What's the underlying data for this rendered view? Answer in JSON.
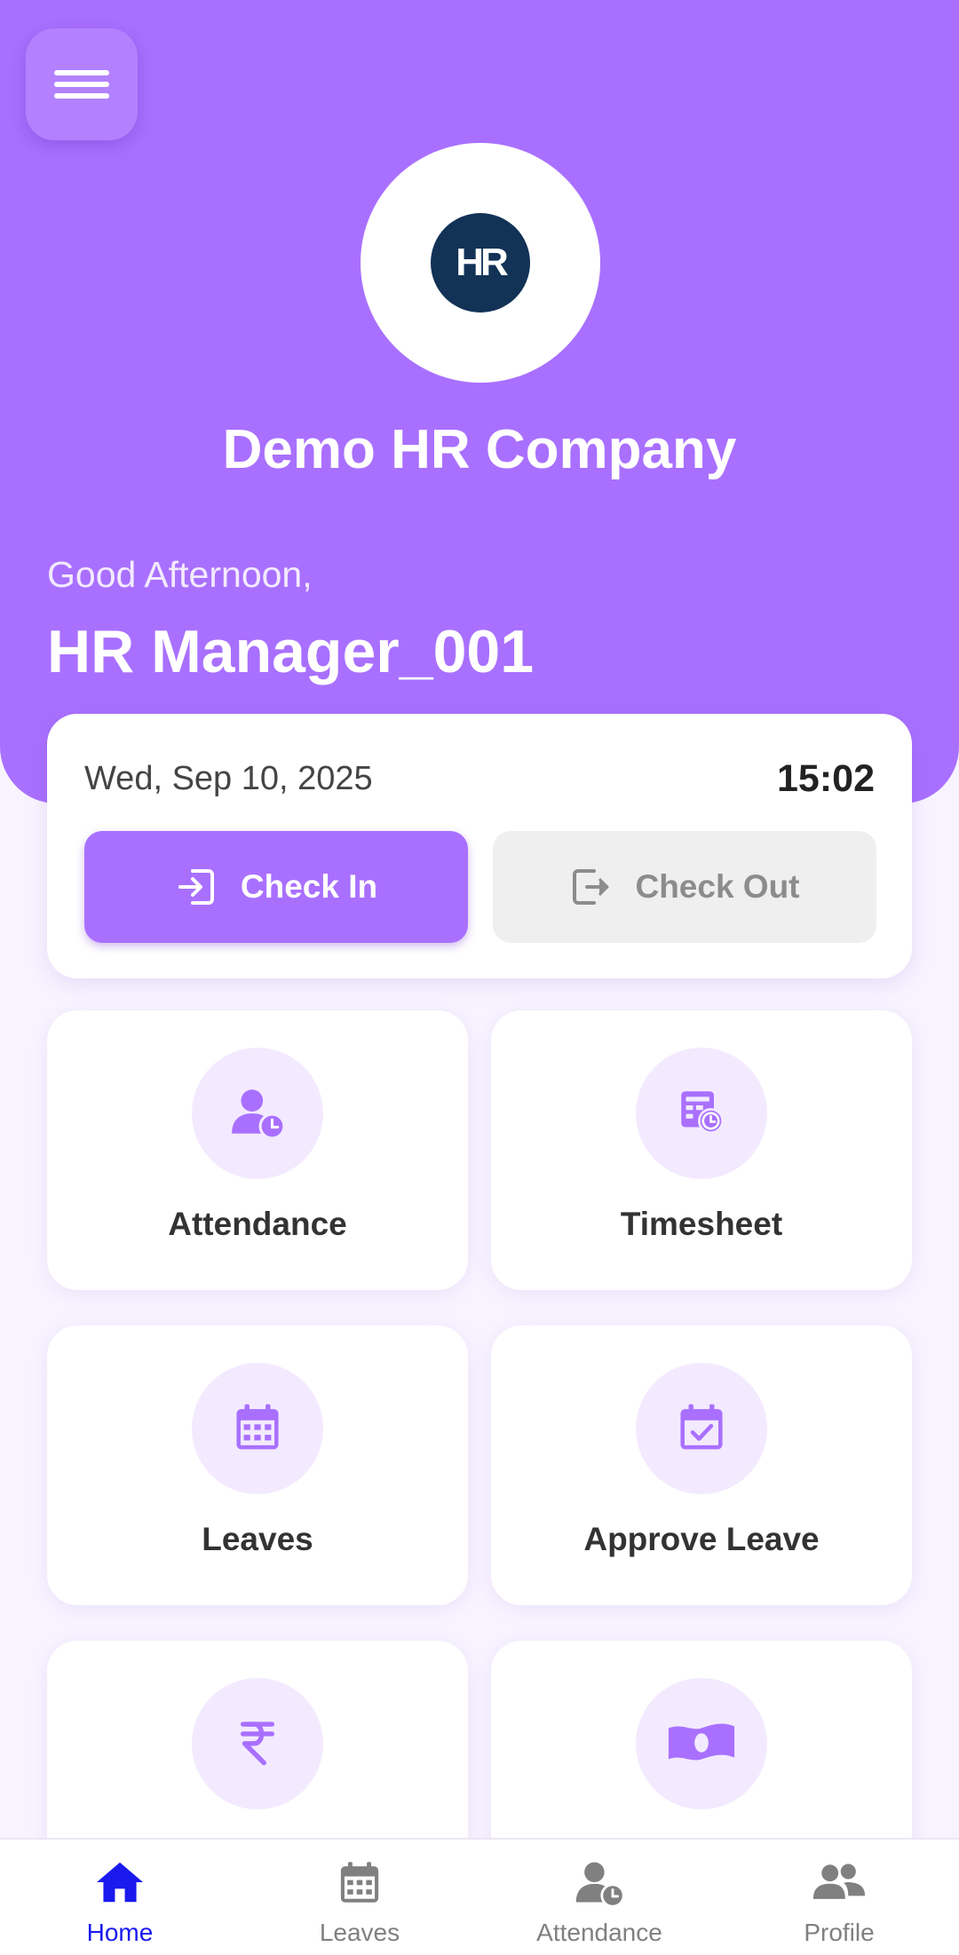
{
  "header": {
    "menu_icon": "hamburger-menu-icon",
    "logo_text": "HR",
    "company_name": "Demo HR Company",
    "greeting": "Good Afternoon,",
    "username": "HR Manager_001",
    "background_color": "#a970ff"
  },
  "attendance_card": {
    "date": "Wed, Sep 10, 2025",
    "time": "15:02",
    "check_in_label": "Check In",
    "check_in_icon": "login-icon",
    "check_out_label": "Check Out",
    "check_out_icon": "logout-icon",
    "check_out_state": "disabled"
  },
  "tiles": [
    {
      "label": "Attendance",
      "icon": "user-clock-icon"
    },
    {
      "label": "Timesheet",
      "icon": "timesheet-clock-icon"
    },
    {
      "label": "Leaves",
      "icon": "calendar-icon"
    },
    {
      "label": "Approve Leave",
      "icon": "calendar-check-icon"
    },
    {
      "label": "",
      "icon": "rupee-icon"
    },
    {
      "label": "",
      "icon": "money-bill-icon"
    }
  ],
  "bottom_nav": [
    {
      "label": "Home",
      "icon": "home-icon",
      "active": true
    },
    {
      "label": "Leaves",
      "icon": "calendar-icon",
      "active": false
    },
    {
      "label": "Attendance",
      "icon": "user-clock-icon",
      "active": false
    },
    {
      "label": "Profile",
      "icon": "users-icon",
      "active": false
    }
  ],
  "colors": {
    "accent": "#a970ff",
    "accent_light": "#f3eaff",
    "active_nav": "#1a1aee",
    "inactive_nav": "#808080"
  }
}
